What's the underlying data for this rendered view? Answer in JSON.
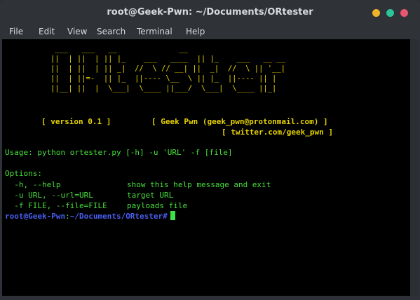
{
  "window": {
    "title": "root@Geek-Pwn: ~/Documents/ORtester"
  },
  "menu": [
    "File",
    "Edit",
    "View",
    "Search",
    "Terminal",
    "Help"
  ],
  "terminal": {
    "banner": [
      "    ___   ___   __              __",
      "   ||  | ||  | || |_    ___   ____  || |_    ___   __ __",
      "   ||  | ||  | || _|  //  \\ // __| ||  _|  //  \\ || '__|",
      "   ||  | ||=-  || |_  ||---- \\__  \\ || |_  ||---- || |",
      "   ||__| ||  |  \\___|  \\____ ||___/  \\___|  \\____ ||_|"
    ],
    "version": "[ version 0.1 ]",
    "author": "[ Geek Pwn (geek_pwn@protonmail.com) ]",
    "twitter": "[ twitter.com/geek_pwn ]",
    "usage": "Usage: python ortester.py [-h] -u 'URL' -f [file]",
    "options_header": "Options:",
    "options": [
      {
        "flag": "  -h, --help",
        "desc": "show this help message and exit"
      },
      {
        "flag": "  -u URL, --url=URL",
        "desc": "target URL"
      },
      {
        "flag": "  -f FILE, --file=FILE",
        "desc": "payloads file"
      }
    ],
    "prompt_user": "root@Geek-Pwn",
    "prompt_sep": ":",
    "prompt_path": "~/Documents/ORtester",
    "prompt_symbol": "#"
  },
  "colors": {
    "banner": "#e6d200",
    "text": "#46e13a",
    "prompt": "#4a5eef",
    "cursor": "#40e04b"
  }
}
